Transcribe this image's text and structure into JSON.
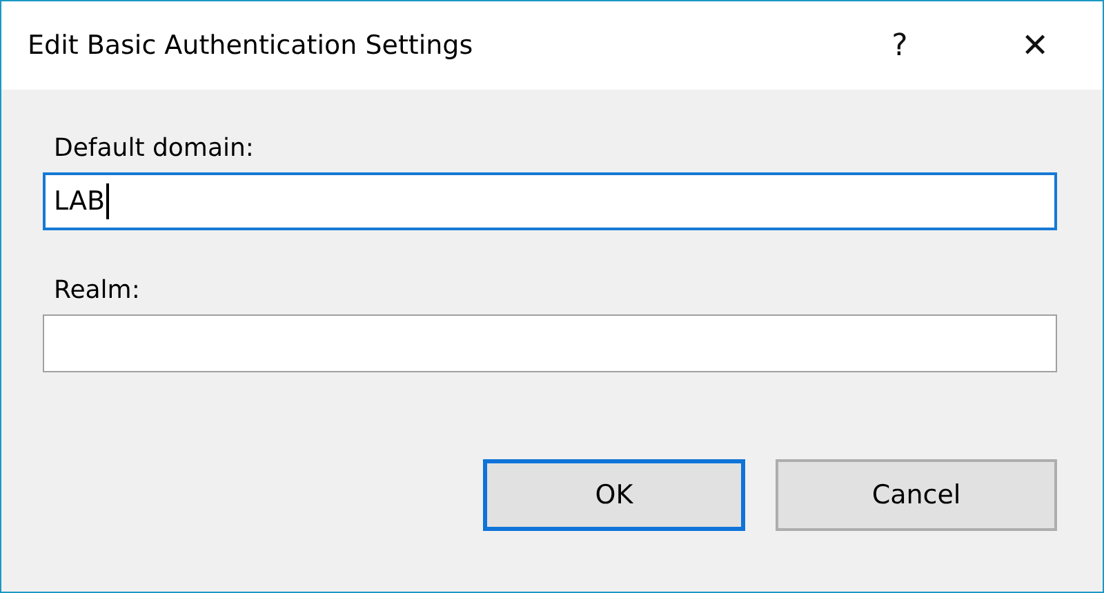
{
  "window": {
    "title": "Edit Basic Authentication Settings",
    "help": "?",
    "close": "✕"
  },
  "fields": [
    {
      "label": "Default domain:",
      "value": "LAB",
      "focused": true
    },
    {
      "label": "Realm:",
      "focused": false
    }
  ],
  "buttons": [
    {
      "label": "OK",
      "default": true
    },
    {
      "label": "Cancel",
      "default": false
    }
  ]
}
